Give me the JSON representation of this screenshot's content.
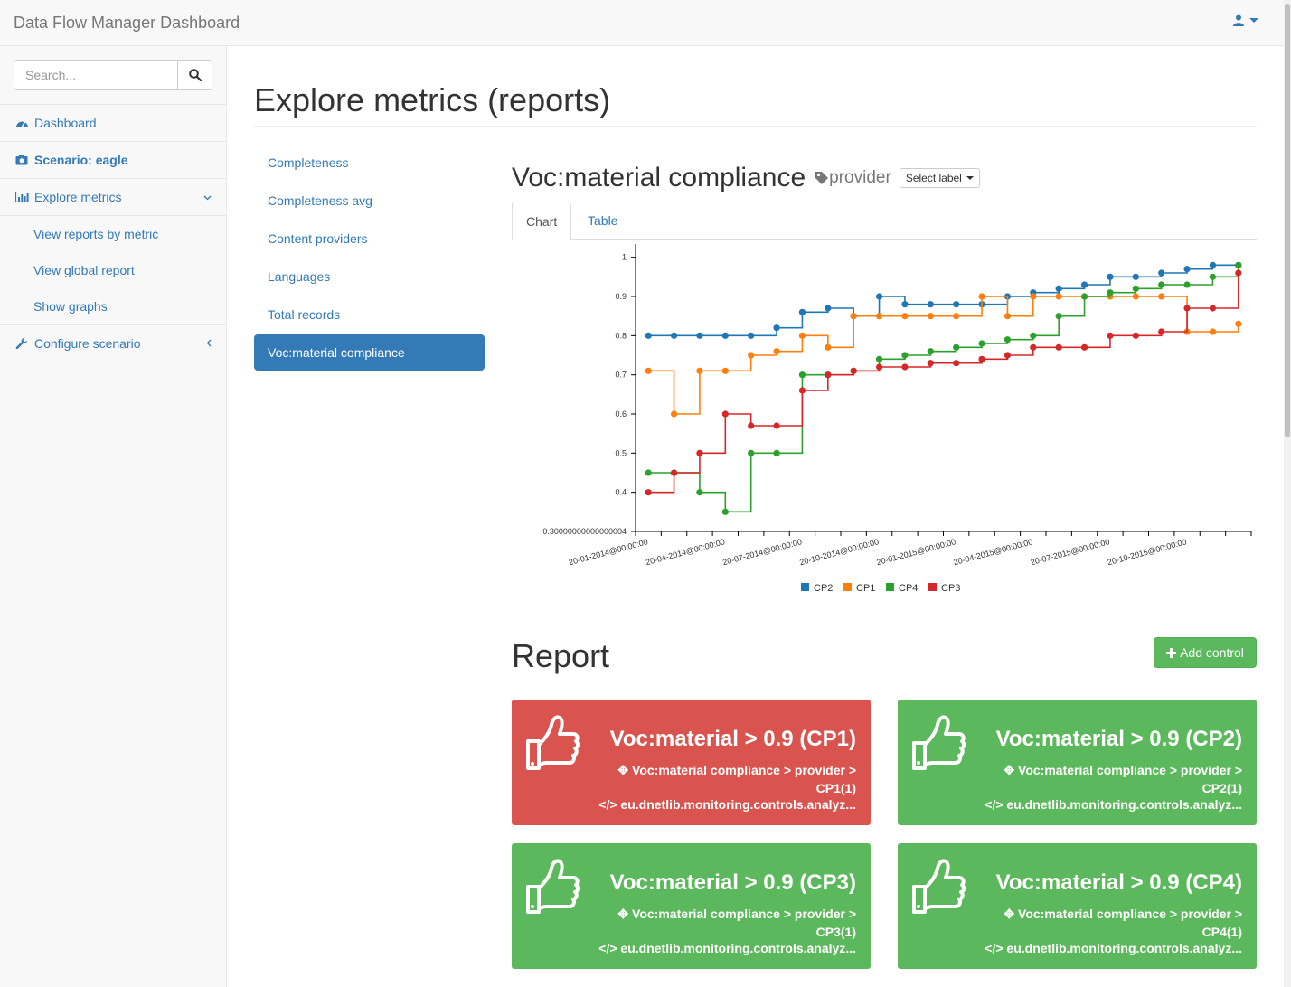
{
  "app": {
    "brand": "Data Flow Manager Dashboard",
    "user_icon": "user-icon"
  },
  "sidebar": {
    "search_placeholder": "Search...",
    "items": [
      {
        "label": "Dashboard",
        "icon": "dashboard-icon"
      },
      {
        "label": "Scenario: eagle",
        "icon": "camera-icon"
      },
      {
        "label": "Explore metrics",
        "icon": "bar-chart-icon",
        "expanded": true
      },
      {
        "label": "Configure scenario",
        "icon": "wrench-icon",
        "expanded": false
      }
    ],
    "sub_items": [
      "View reports by metric",
      "View global report",
      "Show graphs"
    ]
  },
  "main": {
    "page_title": "Explore metrics (reports)",
    "metrics": [
      "Completeness",
      "Completeness avg",
      "Content providers",
      "Languages",
      "Total records",
      "Voc:material compliance"
    ],
    "active_metric": "Voc:material compliance",
    "chart_title": "Voc:material compliance",
    "tag_label": "provider",
    "select_label": "Select label",
    "tabs": [
      "Chart",
      "Table"
    ],
    "active_tab": "Chart"
  },
  "chart_data": {
    "type": "line",
    "interpolation": "step-after",
    "x_tick_labels": [
      "20-01-2014@00:00:00",
      "20-04-2014@00:00:00",
      "20-07-2014@00:00:00",
      "20-10-2014@00:00:00",
      "20-01-2015@00:00:00",
      "20-04-2015@00:00:00",
      "20-07-2015@00:00:00",
      "20-10-2015@00:00:00"
    ],
    "y_tick_labels": [
      "0.30000000000000004",
      "0.4",
      "0.5",
      "0.6",
      "0.7",
      "0.8",
      "0.9",
      "1"
    ],
    "ylim": [
      0.3,
      1.02
    ],
    "n_points": 24,
    "series": [
      {
        "name": "CP2",
        "color": "#1f77b4",
        "values": [
          0.8,
          0.8,
          0.8,
          0.8,
          0.8,
          0.82,
          0.86,
          0.87,
          0.85,
          0.9,
          0.88,
          0.88,
          0.88,
          0.88,
          0.9,
          0.91,
          0.92,
          0.93,
          0.95,
          0.95,
          0.96,
          0.97,
          0.98,
          0.98
        ]
      },
      {
        "name": "CP1",
        "color": "#ff7f0e",
        "values": [
          0.71,
          0.6,
          0.71,
          0.71,
          0.75,
          0.76,
          0.8,
          0.77,
          0.85,
          0.85,
          0.85,
          0.85,
          0.85,
          0.9,
          0.85,
          0.9,
          0.9,
          0.9,
          0.9,
          0.9,
          0.9,
          0.81,
          0.81,
          0.83
        ]
      },
      {
        "name": "CP4",
        "color": "#2ca02c",
        "values": [
          0.45,
          0.45,
          0.4,
          0.35,
          0.5,
          0.5,
          0.7,
          0.7,
          0.71,
          0.74,
          0.75,
          0.76,
          0.77,
          0.78,
          0.79,
          0.8,
          0.85,
          0.9,
          0.91,
          0.92,
          0.93,
          0.93,
          0.95,
          0.98
        ]
      },
      {
        "name": "CP3",
        "color": "#d62728",
        "values": [
          0.4,
          0.45,
          0.5,
          0.6,
          0.57,
          0.57,
          0.66,
          0.7,
          0.71,
          0.72,
          0.72,
          0.73,
          0.73,
          0.74,
          0.75,
          0.77,
          0.77,
          0.77,
          0.8,
          0.8,
          0.81,
          0.87,
          0.87,
          0.96
        ]
      }
    ],
    "legend_position": "bottom"
  },
  "report": {
    "title": "Report",
    "add_button": "Add control",
    "cards": [
      {
        "status": "fail",
        "icon": "thumbs-down-icon",
        "title": "Voc:material > 0.9 (CP1)",
        "path": "Voc:material compliance > provider > CP1(1)",
        "code": "eu.dnetlib.monitoring.controls.analyz..."
      },
      {
        "status": "pass",
        "icon": "thumbs-up-icon",
        "title": "Voc:material > 0.9 (CP2)",
        "path": "Voc:material compliance > provider > CP2(1)",
        "code": "eu.dnetlib.monitoring.controls.analyz..."
      },
      {
        "status": "pass",
        "icon": "thumbs-up-icon",
        "title": "Voc:material > 0.9 (CP3)",
        "path": "Voc:material compliance > provider > CP3(1)",
        "code": "eu.dnetlib.monitoring.controls.analyz..."
      },
      {
        "status": "pass",
        "icon": "thumbs-up-icon",
        "title": "Voc:material > 0.9 (CP4)",
        "path": "Voc:material compliance > provider > CP4(1)",
        "code": "eu.dnetlib.monitoring.controls.analyz..."
      }
    ]
  }
}
